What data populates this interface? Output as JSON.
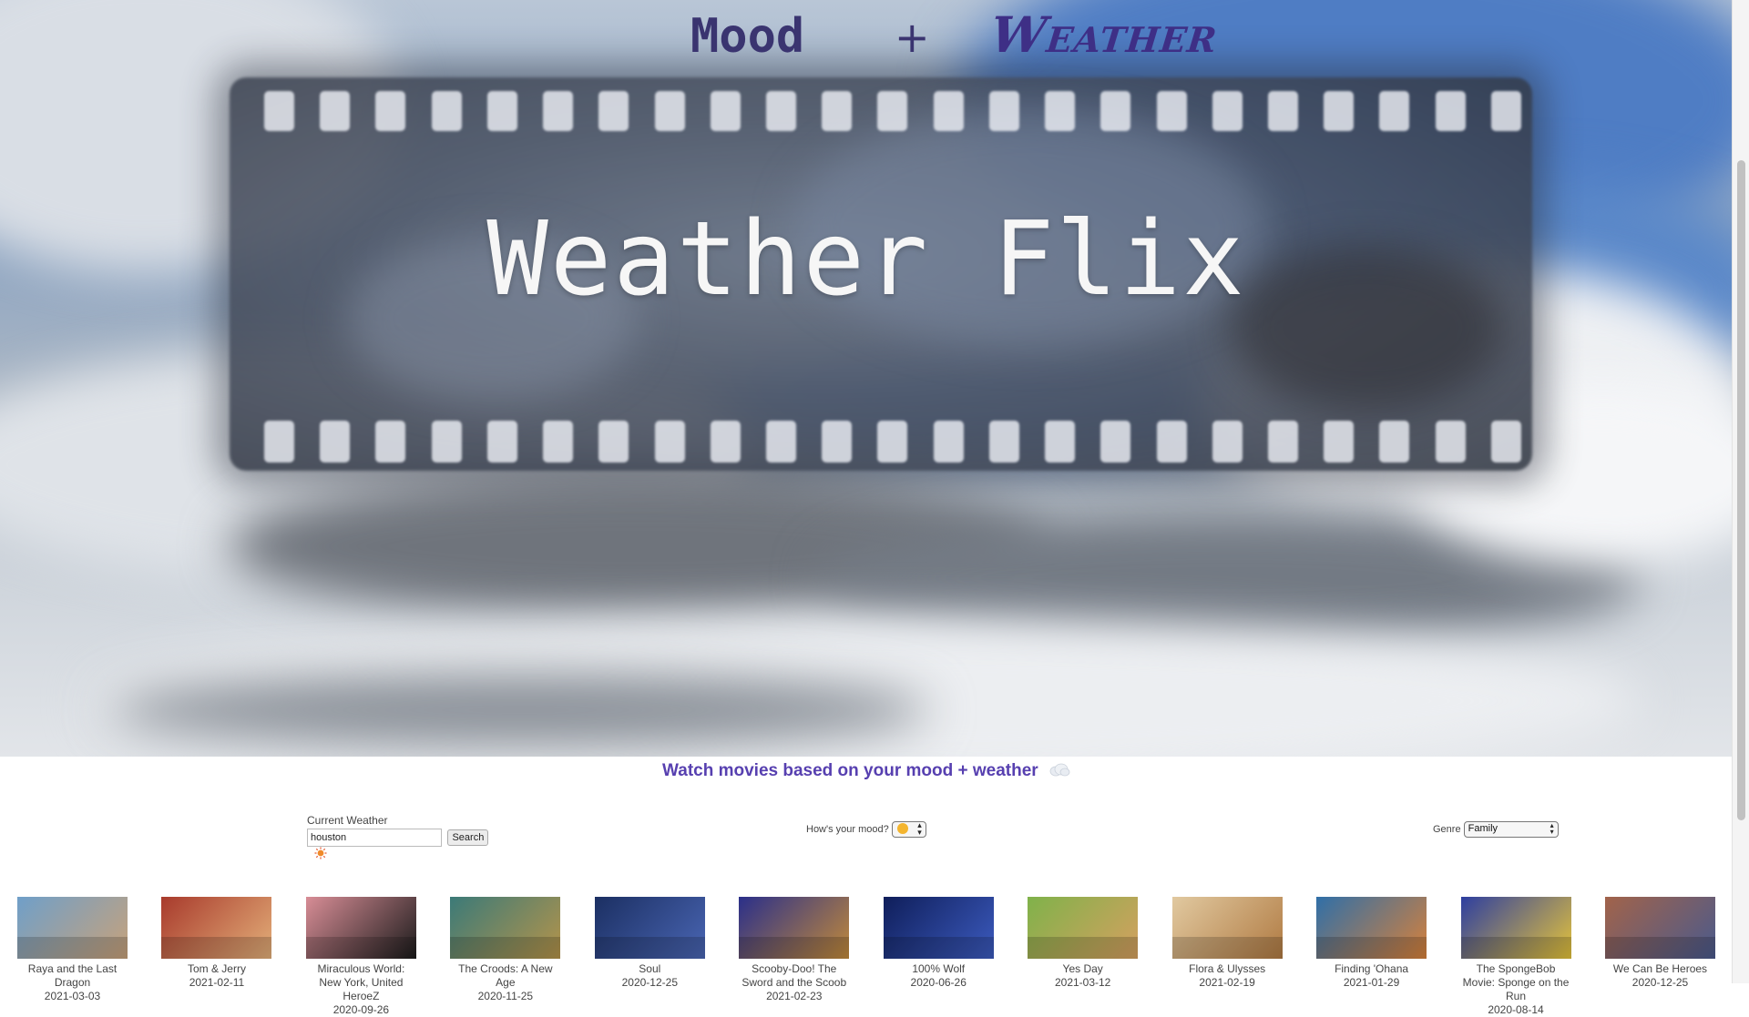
{
  "header": {
    "logo_mood": "Mood",
    "logo_plus": "+",
    "logo_weather": "Weather",
    "hero_title": "Weather Flix"
  },
  "tagline": {
    "text": "Watch movies based on your mood + weather",
    "icon": "cloud-icon"
  },
  "weather": {
    "label": "Current Weather",
    "input_value": "houston",
    "search_label": "Search",
    "status_icon": "sun-icon",
    "status_color": "#e5542b"
  },
  "mood": {
    "label": "How's your mood?",
    "selected_icon": "smiley-face-icon"
  },
  "genre": {
    "label": "Genre",
    "selected": "Family"
  },
  "movies": [
    {
      "title": "Raya and the Last Dragon",
      "date": "2021-03-03",
      "color_a": "#6f9fc9",
      "color_b": "#c8a27a"
    },
    {
      "title": "Tom & Jerry",
      "date": "2021-02-11",
      "color_a": "#a83a2c",
      "color_b": "#e4b07a"
    },
    {
      "title": "Miraculous World: New York, United HeroeZ",
      "date": "2020-09-26",
      "color_a": "#d88d96",
      "color_b": "#1b1b1b"
    },
    {
      "title": "The Croods: A New Age",
      "date": "2020-11-25",
      "color_a": "#3b7a78",
      "color_b": "#b5944a"
    },
    {
      "title": "Soul",
      "date": "2020-12-25",
      "color_a": "#1b2f62",
      "color_b": "#4a66b4"
    },
    {
      "title": "Scooby-Doo! The Sword and the Scoob",
      "date": "2021-02-23",
      "color_a": "#2a2f8a",
      "color_b": "#c28a3a"
    },
    {
      "title": "100% Wolf",
      "date": "2020-06-26",
      "color_a": "#0f1e5a",
      "color_b": "#3c5bbf"
    },
    {
      "title": "Yes Day",
      "date": "2021-03-12",
      "color_a": "#7fb24a",
      "color_b": "#d6a060"
    },
    {
      "title": "Flora & Ulysses",
      "date": "2021-02-19",
      "color_a": "#e1c9a0",
      "color_b": "#b07a42"
    },
    {
      "title": "Finding 'Ohana",
      "date": "2021-01-29",
      "color_a": "#2f6fa8",
      "color_b": "#d8813a"
    },
    {
      "title": "The SpongeBob Movie: Sponge on the Run",
      "date": "2020-08-14",
      "color_a": "#2d3ea0",
      "color_b": "#e6c43a"
    },
    {
      "title": "We Can Be Heroes",
      "date": "2020-12-25",
      "color_a": "#a2634a",
      "color_b": "#4a5a8c"
    }
  ]
}
